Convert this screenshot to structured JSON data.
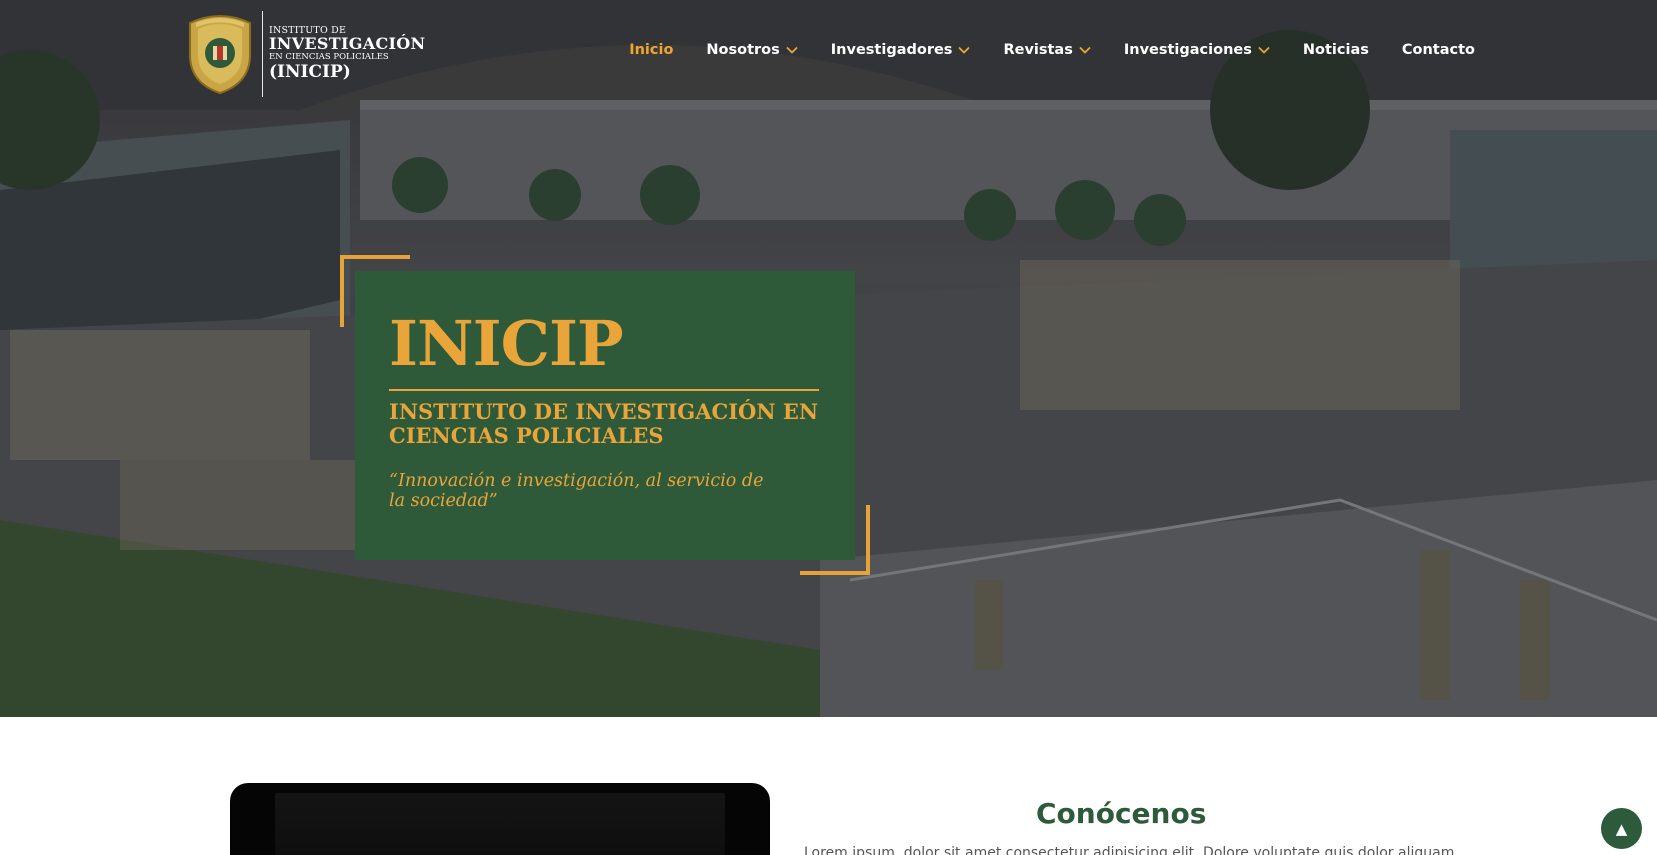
{
  "logo": {
    "line1": "INSTITUTO DE",
    "line2": "INVESTIGACIÓN",
    "line3": "EN CIENCIAS POLICIALES",
    "line4": "(INICIP)"
  },
  "nav": {
    "items": [
      {
        "label": "Inicio",
        "active": true
      },
      {
        "label": "Nosotros",
        "dropdown": true
      },
      {
        "label": "Investigadores",
        "dropdown": true
      },
      {
        "label": "Revistas",
        "dropdown": true
      },
      {
        "label": "Investigaciones",
        "dropdown": true
      },
      {
        "label": "Noticias"
      },
      {
        "label": "Contacto"
      }
    ]
  },
  "hero": {
    "title": "INICIP",
    "subtitle": "INSTITUTO DE INVESTIGACIÓN EN CIENCIAS POLICIALES",
    "quote": "“Innovación e investigación, al servicio de la sociedad”"
  },
  "about": {
    "title": "Conócenos",
    "text": "Lorem ipsum, dolor sit amet consectetur adipisicing elit. Dolore voluptate quis dolor aliquam"
  },
  "colors": {
    "accent": "#e9a43a",
    "brand_green": "#2e5a39",
    "title_green": "#2c5a3b"
  },
  "icons": {
    "back_to_top": "arrow-up-icon",
    "dropdown": "chevron-down-icon",
    "logo": "police-shield-icon"
  },
  "back_to_top": {
    "glyph": "▲"
  }
}
